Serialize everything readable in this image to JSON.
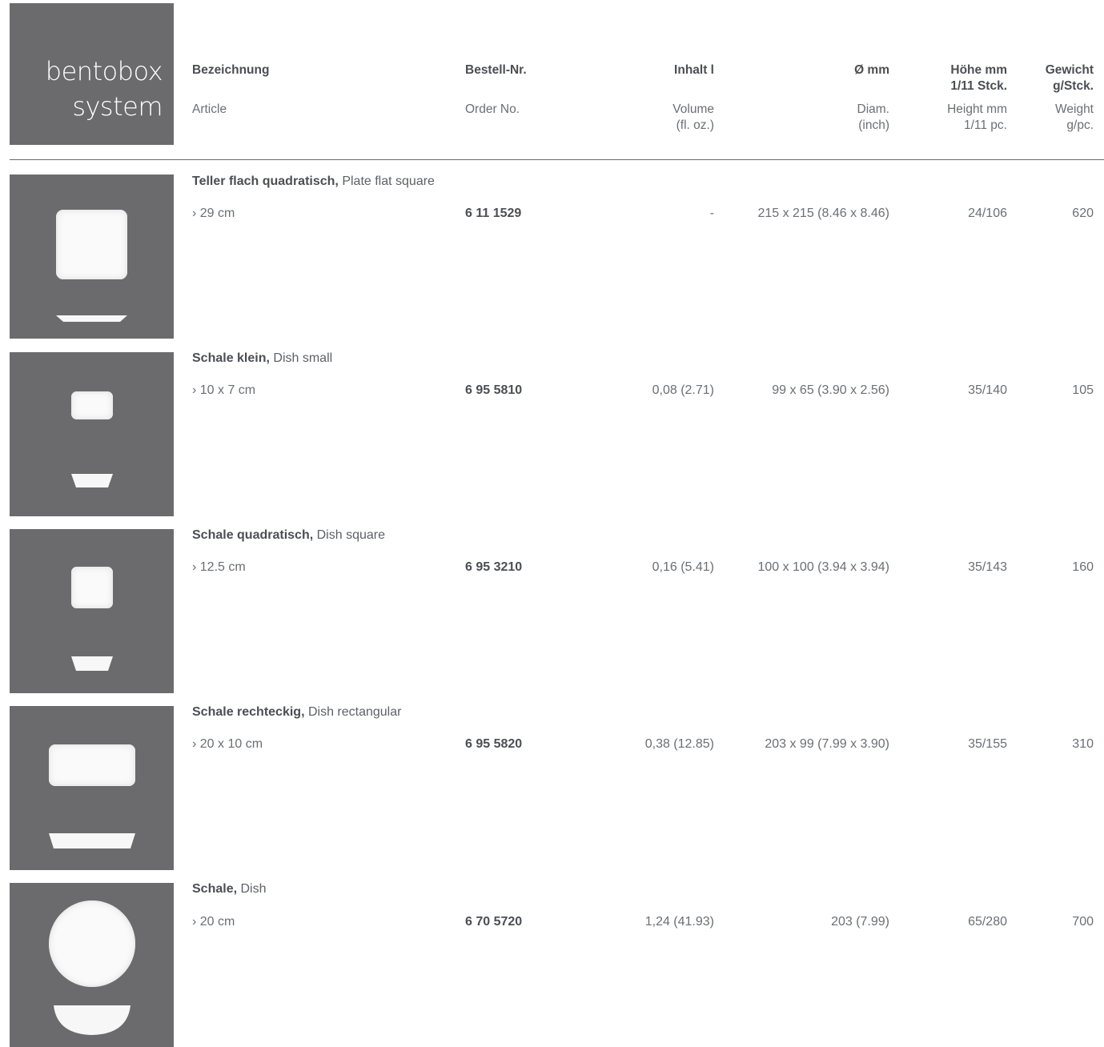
{
  "title": {
    "line1": "bentobox",
    "line2": "system"
  },
  "header": {
    "article_de": "Bezeichnung",
    "article_en": "Article",
    "order_de": "Bestell-Nr.",
    "order_en": "Order No.",
    "volume_de": "Inhalt l",
    "volume_en_1": "Volume",
    "volume_en_2": "(fl. oz.)",
    "diam_de": "Ø mm",
    "diam_en_1": "Diam.",
    "diam_en_2": "(inch)",
    "height_de_1": "Höhe mm",
    "height_de_2": "1/11 Stck.",
    "height_en_1": "Height mm",
    "height_en_2": "1/11 pc.",
    "weight_de_1": "Gewicht",
    "weight_de_2": "g/Stck.",
    "weight_en_1": "Weight",
    "weight_en_2": "g/pc."
  },
  "products": [
    {
      "name_de": "Teller flach quadratisch,",
      "name_en": " Plate flat square",
      "size": "› 29 cm",
      "order": "6 11 1529",
      "volume": "-",
      "diameter": "215 x 215 (8.46 x 8.46)",
      "height": "24/106",
      "weight": "620",
      "image_icon": "square-flat-plate-icon"
    },
    {
      "name_de": "Schale klein,",
      "name_en": " Dish small",
      "size": "› 10 x 7 cm",
      "order": "6 95 5810",
      "volume": "0,08 (2.71)",
      "diameter": "99 x 65 (3.90 x 2.56)",
      "height": "35/140",
      "weight": "105",
      "image_icon": "small-dish-icon"
    },
    {
      "name_de": "Schale quadratisch,",
      "name_en": " Dish square",
      "size": "› 12.5 cm",
      "order": "6 95 3210",
      "volume": "0,16 (5.41)",
      "diameter": "100 x 100 (3.94 x 3.94)",
      "height": "35/143",
      "weight": "160",
      "image_icon": "square-dish-icon"
    },
    {
      "name_de": "Schale rechteckig,",
      "name_en": " Dish rectangular",
      "size": "› 20 x 10 cm",
      "order": "6 95 5820",
      "volume": "0,38 (12.85)",
      "diameter": "203 x 99 (7.99 x 3.90)",
      "height": "35/155",
      "weight": "310",
      "image_icon": "rectangular-dish-icon"
    },
    {
      "name_de": "Schale,",
      "name_en": " Dish",
      "size": "› 20 cm",
      "order": "6 70 5720",
      "volume": "1,24 (41.93)",
      "diameter": "203 (7.99)",
      "height": "65/280",
      "weight": "700",
      "image_icon": "round-dish-icon"
    }
  ]
}
